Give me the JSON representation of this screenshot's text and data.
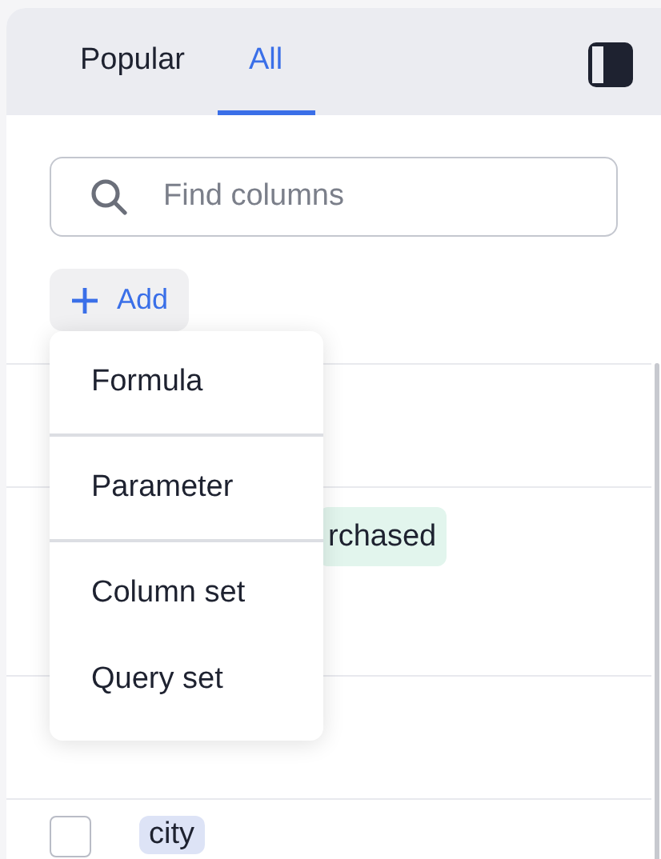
{
  "tabs": [
    {
      "label": "Popular",
      "selected": false
    },
    {
      "label": "All",
      "selected": true
    }
  ],
  "search": {
    "placeholder": "Find columns"
  },
  "add_button": {
    "label": "Add"
  },
  "columns": [
    {
      "kind": "plain",
      "tag": "rchased",
      "color": "#e2f5ed"
    },
    {
      "kind": "checkbox",
      "tag": "city",
      "color": "#dde3f6",
      "checked": false
    }
  ],
  "menu": {
    "groups": [
      [
        "Formula"
      ],
      [
        "Parameter"
      ],
      [
        "Column set",
        "Query set"
      ]
    ]
  }
}
